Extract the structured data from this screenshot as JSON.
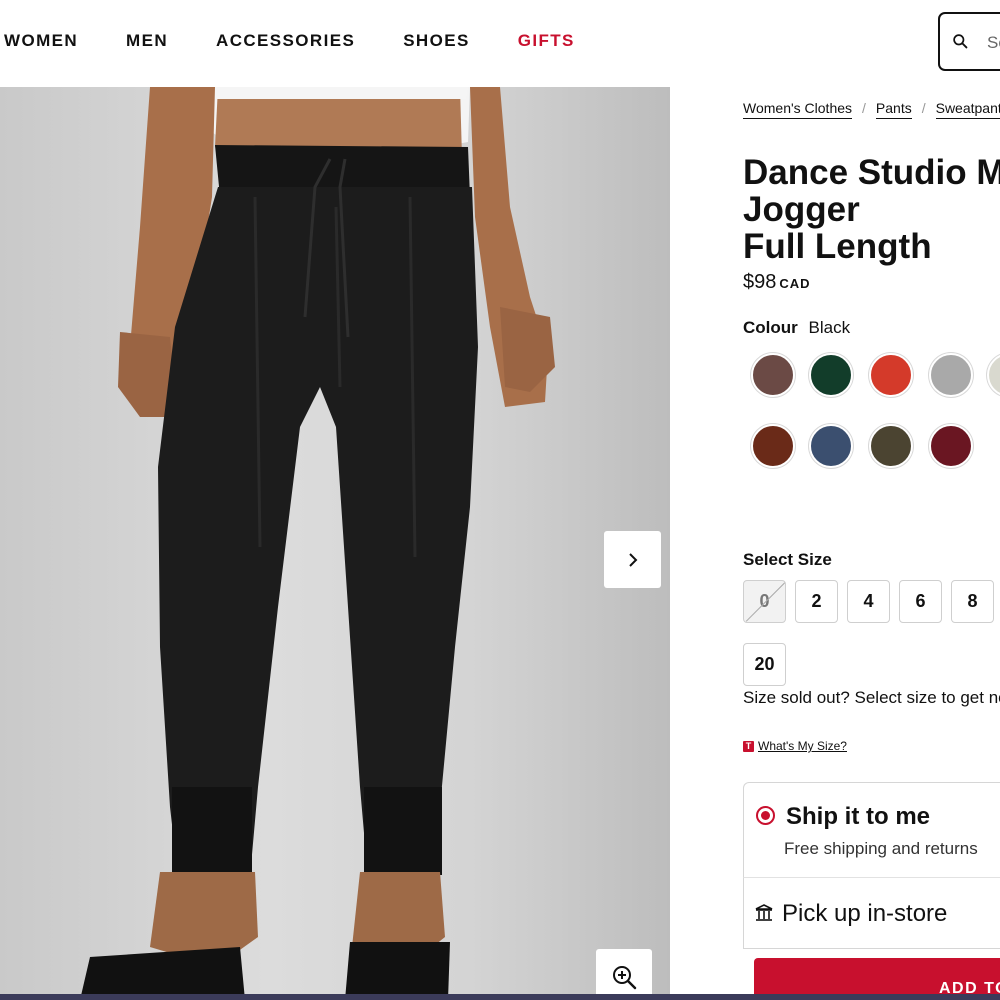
{
  "nav": {
    "items": [
      "WOMEN",
      "MEN",
      "ACCESSORIES",
      "SHOES",
      "GIFTS"
    ],
    "highlight_color": "#c8102e"
  },
  "search": {
    "placeholder": "Search",
    "icon": "search-icon"
  },
  "breadcrumb": [
    "Women's Clothes",
    "Pants",
    "Sweatpants"
  ],
  "product": {
    "title_lines": [
      "Dance Studio Mid-Rise",
      "Jogger",
      "Full Length"
    ],
    "price": "$98",
    "currency": "CAD"
  },
  "colour": {
    "label": "Colour",
    "selected": "Black",
    "swatches": [
      "#6b4a45",
      "#123d2a",
      "#d43a2a",
      "#a9a9a9",
      "#d9d9cf",
      "#6a2a18",
      "#3b4f6f",
      "#4b4431",
      "#6a1622"
    ]
  },
  "size": {
    "label": "Select Size",
    "options": [
      "0",
      "2",
      "4",
      "6",
      "8",
      "20"
    ],
    "sold_out": [
      "0"
    ],
    "sold_out_text": "Size sold out? Select size to get notified",
    "whats_my_size": "What's My Size?",
    "badge": "T"
  },
  "delivery": {
    "ship_title": "Ship it to me",
    "ship_subtitle": "Free shipping and returns",
    "pickup_title": "Pick up in-store"
  },
  "cart": {
    "add_label": "ADD TO BAG"
  },
  "image_controls": {
    "next_icon": "chevron-right-icon",
    "zoom_icon": "zoom-in-icon"
  }
}
